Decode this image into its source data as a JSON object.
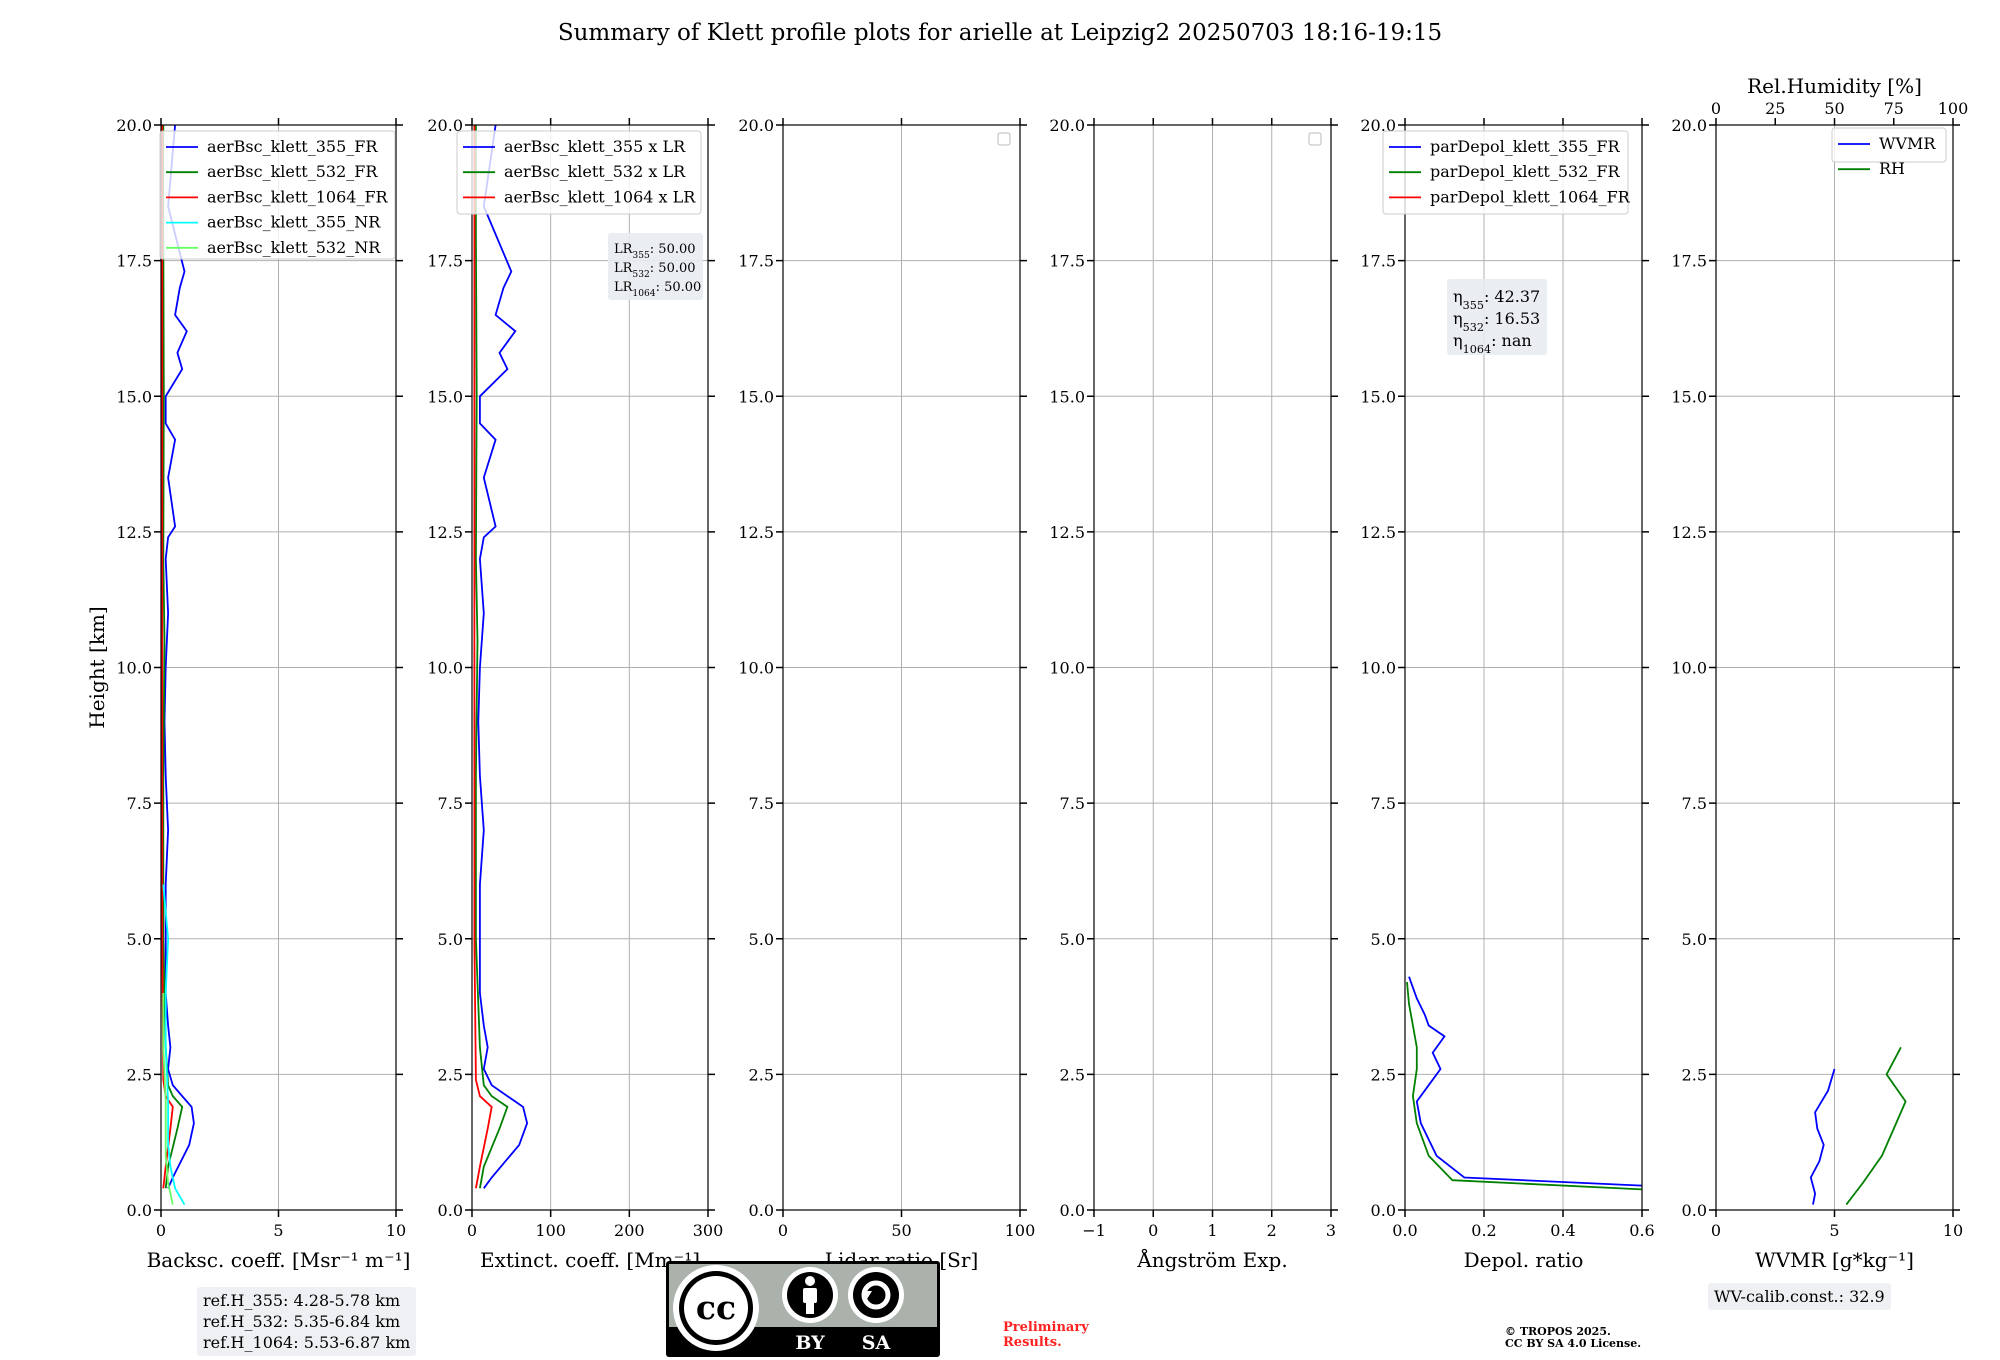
{
  "title": "Summary of Klett profile plots for arielle at Leipzig2 20250703 18:16-19:15",
  "colors": {
    "blue": "#0000ff",
    "green": "#008000",
    "red": "#ff0000",
    "cyan": "#00ffff",
    "lightgreen": "#66ff66",
    "lightblue": "#b8b8ff",
    "grid": "#b0b0b0",
    "prelim": "#ff2020"
  },
  "chart_data": [
    {
      "type": "line",
      "ylabel": "Height [km]",
      "xlabel": "Backsc. coeff. [Msr⁻¹ m⁻¹]",
      "xlim": [
        0,
        10
      ],
      "ylim": [
        0,
        20
      ],
      "xticks": [
        "0",
        "5",
        "10"
      ],
      "yticks": [
        "0.0",
        "2.5",
        "5.0",
        "7.5",
        "10.0",
        "12.5",
        "15.0",
        "17.5",
        "20.0"
      ],
      "grid": true,
      "legend_position": "upper-right",
      "series": [
        {
          "name": "aerBsc_klett_355_FR",
          "color": "#0000ff",
          "x": [
            0.3,
            0.5,
            1.2,
            1.4,
            1.3,
            0.9,
            0.5,
            0.3,
            0.4,
            0.3,
            0.2,
            0.2,
            0.2,
            0.3,
            0.2,
            0.15,
            0.2,
            0.3,
            0.2,
            0.3,
            0.6,
            0.3,
            0.6,
            0.2,
            0.2,
            0.9,
            0.7,
            1.1,
            0.6,
            0.8,
            1.0,
            0.3,
            0.6
          ],
          "y": [
            0.4,
            0.6,
            1.2,
            1.6,
            1.9,
            2.1,
            2.3,
            2.6,
            3.0,
            3.4,
            4.0,
            5.0,
            6.0,
            7.0,
            8.0,
            9.0,
            10.0,
            11.0,
            12.0,
            12.4,
            12.6,
            13.5,
            14.2,
            14.5,
            15.0,
            15.5,
            15.8,
            16.2,
            16.5,
            17.0,
            17.3,
            18.5,
            20.0
          ]
        },
        {
          "name": "aerBsc_klett_532_FR",
          "color": "#008000",
          "x": [
            0.2,
            0.3,
            0.7,
            0.9,
            0.5,
            0.3,
            0.2,
            0.1,
            0.1,
            0.15,
            0.1,
            0.12,
            0.1,
            0.1
          ],
          "y": [
            0.4,
            0.8,
            1.5,
            1.9,
            2.1,
            2.3,
            3.0,
            5.0,
            8.0,
            10.5,
            12.0,
            15.0,
            18.0,
            20.0
          ]
        },
        {
          "name": "aerBsc_klett_1064_FR",
          "color": "#ff0000",
          "x": [
            0.1,
            0.2,
            0.4,
            0.5,
            0.2,
            0.1,
            0.05,
            0.05,
            0.05
          ],
          "y": [
            0.4,
            0.8,
            1.5,
            1.9,
            2.1,
            2.4,
            5.0,
            12.0,
            20.0
          ]
        },
        {
          "name": "aerBsc_klett_355_NR",
          "color": "#00ffff",
          "x": [
            1.0,
            0.6,
            0.4,
            0.3,
            0.3,
            0.2,
            0.2,
            0.3,
            0.1
          ],
          "y": [
            0.1,
            0.4,
            0.8,
            1.2,
            2.0,
            3.0,
            4.0,
            5.0,
            6.0
          ]
        },
        {
          "name": "aerBsc_klett_532_NR",
          "color": "#66ff66",
          "x": [
            0.5,
            0.3,
            0.2,
            0.2,
            0.1,
            0.1
          ],
          "y": [
            0.1,
            0.5,
            1.0,
            2.0,
            3.0,
            4.0
          ]
        }
      ],
      "info": [
        "ref.H_355: 4.28-5.78 km",
        "ref.H_532: 5.35-6.84 km",
        "ref.H_1064: 5.53-6.87 km"
      ]
    },
    {
      "type": "line",
      "xlabel": "Extinct. coeff. [Mm⁻¹]",
      "xlim": [
        0,
        300
      ],
      "ylim": [
        0,
        20
      ],
      "xticks": [
        "0",
        "100",
        "200",
        "300"
      ],
      "yticks": [
        "0.0",
        "2.5",
        "5.0",
        "7.5",
        "10.0",
        "12.5",
        "15.0",
        "17.5",
        "20.0"
      ],
      "grid": true,
      "legend_position": "upper-right",
      "series": [
        {
          "name": "aerBsc_klett_355 x LR",
          "color": "#0000ff",
          "x": [
            15,
            25,
            60,
            70,
            65,
            45,
            25,
            15,
            20,
            15,
            10,
            10,
            10,
            15,
            10,
            8,
            10,
            15,
            10,
            15,
            30,
            15,
            30,
            10,
            10,
            45,
            35,
            55,
            30,
            40,
            50,
            15,
            30
          ],
          "y": [
            0.4,
            0.6,
            1.2,
            1.6,
            1.9,
            2.1,
            2.3,
            2.6,
            3.0,
            3.4,
            4.0,
            5.0,
            6.0,
            7.0,
            8.0,
            9.0,
            10.0,
            11.0,
            12.0,
            12.4,
            12.6,
            13.5,
            14.2,
            14.5,
            15.0,
            15.5,
            15.8,
            16.2,
            16.5,
            17.0,
            17.3,
            18.5,
            20.0
          ]
        },
        {
          "name": "aerBsc_klett_532 x LR",
          "color": "#008000",
          "x": [
            10,
            15,
            35,
            45,
            25,
            15,
            10,
            5,
            5,
            7,
            5,
            6,
            5,
            5
          ],
          "y": [
            0.4,
            0.8,
            1.5,
            1.9,
            2.1,
            2.3,
            3.0,
            5.0,
            8.0,
            10.5,
            12.0,
            15.0,
            18.0,
            20.0
          ]
        },
        {
          "name": "aerBsc_klett_1064 x LR",
          "color": "#ff0000",
          "x": [
            5,
            10,
            20,
            25,
            10,
            5,
            3,
            3,
            3
          ],
          "y": [
            0.4,
            0.8,
            1.5,
            1.9,
            2.1,
            2.4,
            5.0,
            12.0,
            20.0
          ]
        }
      ],
      "annotation": {
        "lines": [
          {
            "base": "LR",
            "sub": "355",
            "value": ": 50.00"
          },
          {
            "base": "LR",
            "sub": "532",
            "value": ": 50.00"
          },
          {
            "base": "LR",
            "sub": "1064",
            "value": ": 50.00"
          }
        ]
      }
    },
    {
      "type": "line",
      "xlabel": "Lidar ratio [Sr]",
      "xlim": [
        0,
        120
      ],
      "ylim": [
        0,
        20
      ],
      "xticks": [
        "0",
        "50",
        "100"
      ],
      "yticks": [
        "0.0",
        "2.5",
        "5.0",
        "7.5",
        "10.0",
        "12.5",
        "15.0",
        "17.5",
        "20.0"
      ],
      "grid": true,
      "legend_position": "upper-right",
      "series": []
    },
    {
      "type": "line",
      "xlabel": "Ångström Exp.",
      "xlim": [
        -1,
        3
      ],
      "ylim": [
        0,
        20
      ],
      "xticks": [
        "−1",
        "0",
        "1",
        "2",
        "3"
      ],
      "yticks": [
        "0.0",
        "2.5",
        "5.0",
        "7.5",
        "10.0",
        "12.5",
        "15.0",
        "17.5",
        "20.0"
      ],
      "grid": true,
      "legend_position": "upper-right",
      "series": []
    },
    {
      "type": "line",
      "xlabel": "Depol. ratio",
      "xlim": [
        0,
        0.6
      ],
      "ylim": [
        0,
        20
      ],
      "xticks": [
        "0.0",
        "0.2",
        "0.4",
        "0.6"
      ],
      "yticks": [
        "0.0",
        "2.5",
        "5.0",
        "7.5",
        "10.0",
        "12.5",
        "15.0",
        "17.5",
        "20.0"
      ],
      "grid": true,
      "legend_position": "upper-right",
      "series": [
        {
          "name": "parDepol_klett_355_FR",
          "color": "#0000ff",
          "x": [
            0.6,
            0.15,
            0.08,
            0.04,
            0.03,
            0.06,
            0.09,
            0.07,
            0.1,
            0.06,
            0.05,
            0.03,
            0.02,
            0.01
          ],
          "y": [
            0.45,
            0.6,
            1.0,
            1.6,
            2.0,
            2.3,
            2.6,
            2.9,
            3.2,
            3.4,
            3.6,
            3.9,
            4.1,
            4.3
          ]
        },
        {
          "name": "parDepol_klett_532_FR",
          "color": "#008000",
          "x": [
            0.6,
            0.12,
            0.06,
            0.03,
            0.02,
            0.03,
            0.03,
            0.02,
            0.01,
            0.005
          ],
          "y": [
            0.38,
            0.55,
            1.0,
            1.6,
            2.1,
            2.6,
            3.0,
            3.4,
            3.8,
            4.2
          ]
        },
        {
          "name": "parDepol_klett_1064_FR",
          "color": "#ff0000",
          "x": [],
          "y": []
        }
      ],
      "annotation": {
        "lines": [
          {
            "base": "η",
            "sub": "355",
            "value": ": 42.37"
          },
          {
            "base": "η",
            "sub": "532",
            "value": ": 16.53"
          },
          {
            "base": "η",
            "sub": "1064",
            "value": ": nan"
          }
        ]
      }
    },
    {
      "type": "line",
      "xlabel": "WVMR [g*kg⁻¹]",
      "xlim": [
        0,
        11
      ],
      "ylim": [
        0,
        20
      ],
      "xticks": [
        "0",
        "5",
        "10"
      ],
      "yticks": [
        "0.0",
        "2.5",
        "5.0",
        "7.5",
        "10.0",
        "12.5",
        "15.0",
        "17.5",
        "20.0"
      ],
      "top_axis": {
        "label": "Rel.Humidity [%]",
        "xlim": [
          0,
          100
        ],
        "xticks": [
          "0",
          "25",
          "50",
          "75",
          "100"
        ]
      },
      "grid": true,
      "legend_position": "upper-right",
      "series": [
        {
          "name": "WVMR",
          "color": "#0000ff",
          "axis": "bottom",
          "x": [
            4.5,
            4.6,
            4.4,
            4.8,
            5.0,
            4.7,
            4.6,
            5.2,
            5.5
          ],
          "y": [
            0.1,
            0.3,
            0.6,
            0.9,
            1.2,
            1.5,
            1.8,
            2.2,
            2.6
          ]
        },
        {
          "name": "RH",
          "color": "#008000",
          "axis": "top",
          "x": [
            55,
            62,
            70,
            75,
            80,
            72,
            78
          ],
          "y": [
            0.1,
            0.5,
            1.0,
            1.5,
            2.0,
            2.5,
            3.0
          ]
        }
      ],
      "info": [
        "WV-calib.const.: 32.9"
      ]
    }
  ],
  "badge": {
    "by": "BY",
    "sa": "SA",
    "cc": "cc"
  },
  "footer": {
    "preliminary": [
      "Preliminary",
      "Results."
    ],
    "copyright": [
      "© TROPOS 2025.",
      "CC BY SA 4.0 License."
    ]
  }
}
